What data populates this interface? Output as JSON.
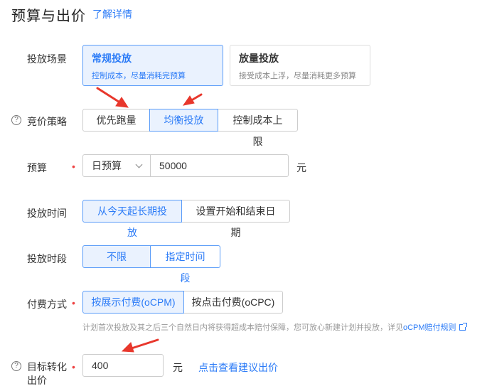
{
  "header": {
    "title": "预算与出价",
    "learn_more": "了解详情"
  },
  "scene": {
    "label": "投放场景",
    "options": [
      {
        "title": "常规投放",
        "desc": "控制成本，尽量消耗完预算",
        "active": true
      },
      {
        "title": "放量投放",
        "desc": "接受成本上浮，尽量消耗更多预算",
        "active": false
      }
    ]
  },
  "strategy": {
    "label": "竞价策略",
    "options": [
      "优先跑量",
      "均衡投放",
      "控制成本上限"
    ],
    "selected": "均衡投放"
  },
  "budget": {
    "label": "预算",
    "type": "日预算",
    "value": "50000",
    "unit": "元"
  },
  "schedule_time": {
    "label": "投放时间",
    "options": [
      "从今天起长期投放",
      "设置开始和结束日期"
    ],
    "selected": "从今天起长期投放"
  },
  "schedule_period": {
    "label": "投放时段",
    "options": [
      "不限",
      "指定时间段"
    ],
    "selected": "不限"
  },
  "billing": {
    "label": "付费方式",
    "options": [
      "按展示付费(oCPM)",
      "按点击付费(oCPC)"
    ],
    "selected": "按展示付费(oCPM)",
    "hint": "计划首次投放及其之后三个自然日内将获得超成本赔付保障，您可放心新建计划并投放，详见",
    "hint_link": "oCPM赔付规则"
  },
  "target_bid": {
    "label_line1": "目标转化",
    "label_line2": "出价",
    "value": "400",
    "unit": "元",
    "suggest_link": "点击查看建议出价"
  },
  "colors": {
    "accent": "#2b7bf7",
    "active_bg": "#eaf2fe",
    "required": "#ee4444",
    "arrow": "#e8372c"
  }
}
